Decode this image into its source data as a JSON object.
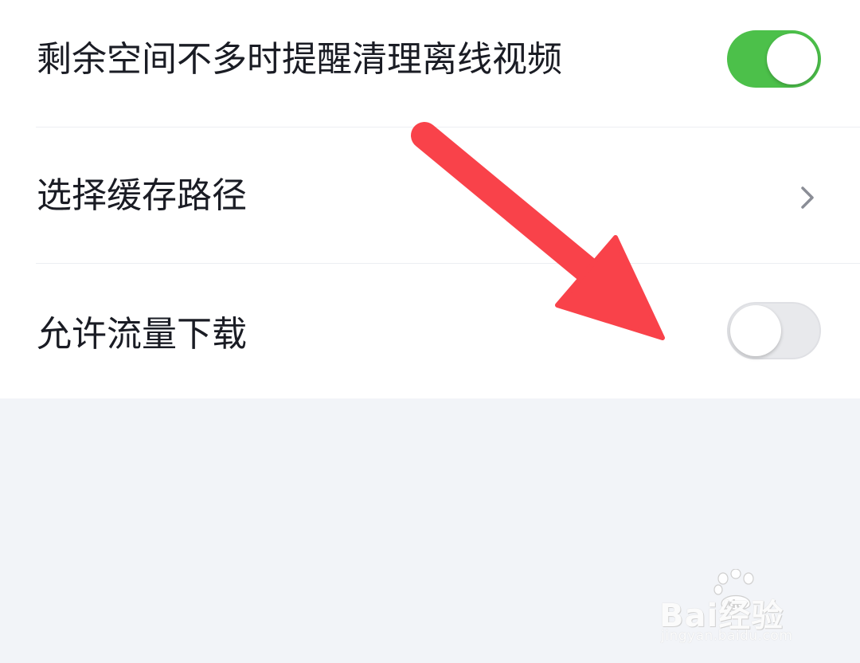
{
  "settings": {
    "items": [
      {
        "label": "剩余空间不多时提醒清理离线视频",
        "control": "toggle",
        "state": "on"
      },
      {
        "label": "选择缓存路径",
        "control": "chevron",
        "icon": "chevron-right-icon"
      },
      {
        "label": "允许流量下载",
        "control": "toggle",
        "state": "off"
      }
    ]
  },
  "colors": {
    "toggle_on": "#4cc04a",
    "toggle_off": "#e8e9ec",
    "annotation_arrow": "#f9424a",
    "page_background": "#f2f4f8"
  },
  "watermark": {
    "logo_text": "Bai经验",
    "paw_text": "du",
    "url": "jingyan.baidu.com"
  }
}
